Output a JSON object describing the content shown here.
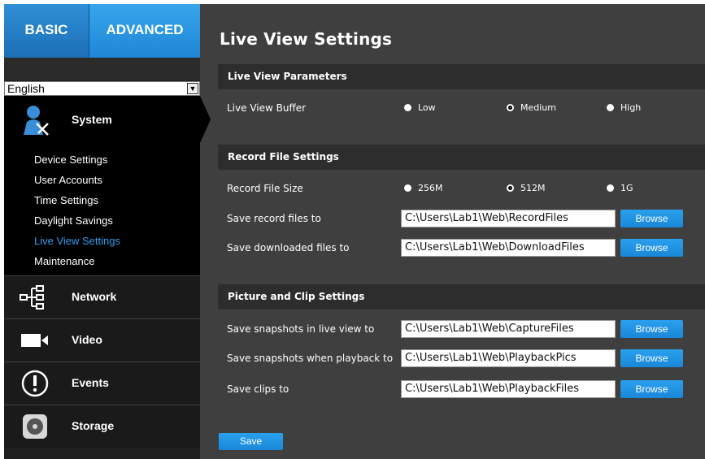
{
  "tabs": {
    "basic": "BASIC",
    "advanced": "ADVANCED"
  },
  "language": {
    "selected": "English"
  },
  "nav": {
    "system": "System",
    "network": "Network",
    "video": "Video",
    "events": "Events",
    "storage": "Storage"
  },
  "submenu": [
    {
      "label": "Device Settings",
      "active": false
    },
    {
      "label": "User Accounts",
      "active": false
    },
    {
      "label": "Time Settings",
      "active": false
    },
    {
      "label": "Daylight Savings",
      "active": false
    },
    {
      "label": "Live View Settings",
      "active": true
    },
    {
      "label": "Maintenance",
      "active": false
    }
  ],
  "page": {
    "title": "Live View Settings"
  },
  "live_view": {
    "heading": "Live View Parameters",
    "buffer_label": "Live View Buffer",
    "options": [
      "Low",
      "Medium",
      "High"
    ],
    "selected": "Medium"
  },
  "record": {
    "heading": "Record File Settings",
    "size_label": "Record File Size",
    "size_options": [
      "256M",
      "512M",
      "1G"
    ],
    "size_selected": "512M",
    "record_label": "Save record files to",
    "record_path": "C:\\Users\\Lab1\\Web\\RecordFiles",
    "download_label": "Save downloaded files to",
    "download_path": "C:\\Users\\Lab1\\Web\\DownloadFiles"
  },
  "picture": {
    "heading": "Picture and Clip Settings",
    "snap_live_label": "Save snapshots in live view to",
    "snap_live_path": "C:\\Users\\Lab1\\Web\\CaptureFiles",
    "snap_play_label": "Save snapshots when playback to",
    "snap_play_path": "C:\\Users\\Lab1\\Web\\PlaybackPics",
    "clips_label": "Save clips to",
    "clips_path": "C:\\Users\\Lab1\\Web\\PlaybackFiles"
  },
  "buttons": {
    "browse": "Browse",
    "save": "Save"
  },
  "colors": {
    "accent": "#1f86d6",
    "active_link": "#2f9df0"
  }
}
